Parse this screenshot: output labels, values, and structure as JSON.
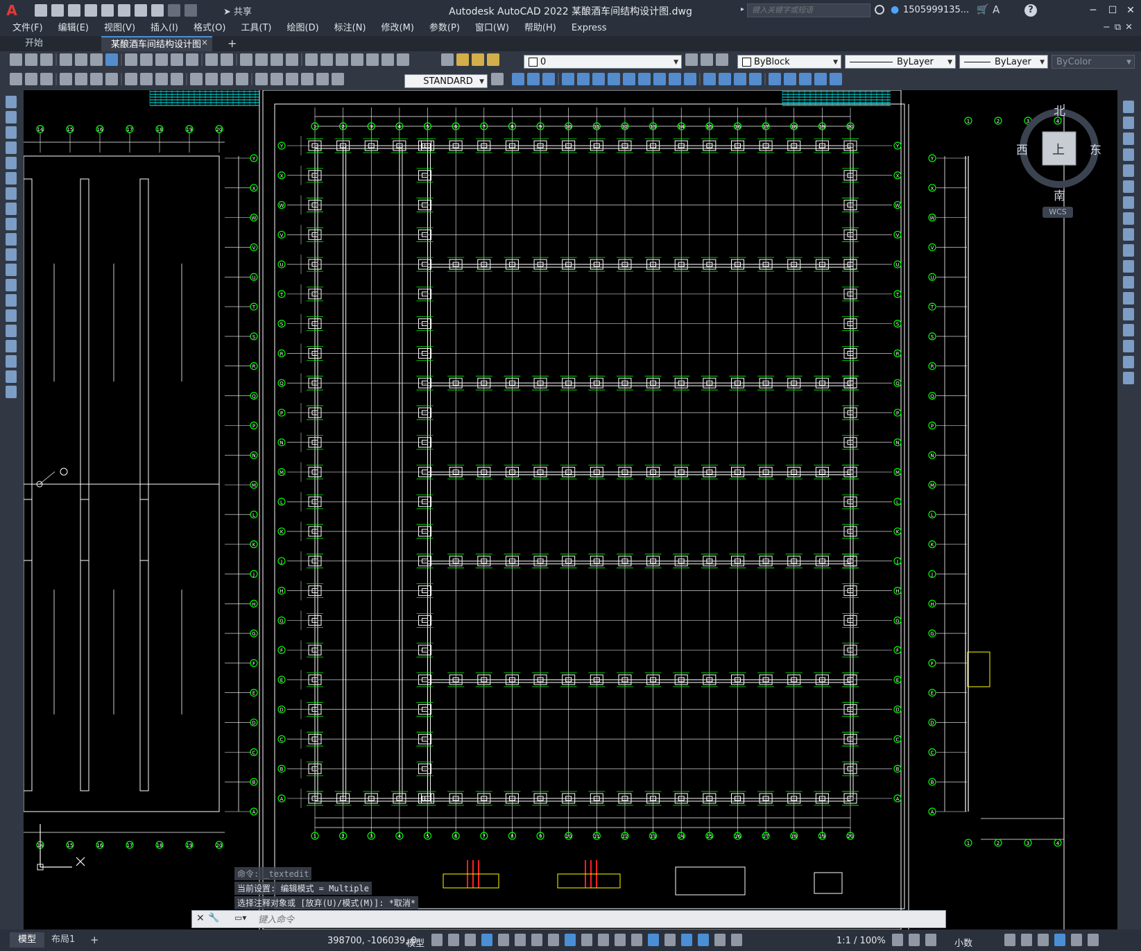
{
  "window": {
    "title": "Autodesk AutoCAD 2022    某酿酒车间结构设计图.dwg",
    "share_label": "共享",
    "search_placeholder": "键入关键字或短语",
    "user_name": "1505999135...",
    "minimize": "─",
    "maximize": "☐",
    "close": "✕",
    "logo": "A"
  },
  "menu": [
    "文件(F)",
    "编辑(E)",
    "视图(V)",
    "插入(I)",
    "格式(O)",
    "工具(T)",
    "绘图(D)",
    "标注(N)",
    "修改(M)",
    "参数(P)",
    "窗口(W)",
    "帮助(H)",
    "Express"
  ],
  "tabs": {
    "start": "开始",
    "document": "某酿酒车间结构设计图*",
    "doc_close": "×",
    "new": "+"
  },
  "properties": {
    "layer": "0",
    "color": "ByBlock",
    "linetype": "ByLayer",
    "lineweight": "ByLayer",
    "plot_style": "ByColor",
    "text_style": "STANDARD"
  },
  "viewcube": {
    "north": "北",
    "south": "南",
    "east": "东",
    "west": "西",
    "top": "上",
    "wcs": "WCS"
  },
  "command": {
    "history": [
      "命令: _textedit",
      "当前设置: 编辑模式 = Multiple",
      "选择注释对象或 [放弃(U)/模式(M)]: *取消*"
    ],
    "placeholder": "键入命令"
  },
  "status": {
    "model_tab": "模型",
    "layout_tab": "布局1",
    "add_tab": "+",
    "coordinates": "398700, -106039, 0",
    "space": "模型",
    "scale": "1:1 / 100%",
    "units": "小数"
  },
  "drawing": {
    "row_labels": [
      "Y",
      "X",
      "W",
      "V",
      "U",
      "T",
      "S",
      "R",
      "Q",
      "P",
      "N",
      "M",
      "L",
      "K",
      "J",
      "H",
      "G",
      "F",
      "E",
      "D",
      "C",
      "B",
      "A"
    ],
    "col_labels": [
      "1",
      "2",
      "3",
      "4",
      "5",
      "6",
      "7",
      "8",
      "9",
      "10",
      "11",
      "12",
      "13",
      "14",
      "15",
      "16",
      "17",
      "18",
      "19",
      "20"
    ],
    "left_col_labels": [
      "14",
      "15",
      "16",
      "17",
      "18",
      "19",
      "20"
    ],
    "colors": {
      "background": "#000000",
      "lines": "#ffffff",
      "bubbles": "#00ff00",
      "accent": "#00ffff",
      "rebar": "#ff2020",
      "note": "#ffff00"
    }
  }
}
